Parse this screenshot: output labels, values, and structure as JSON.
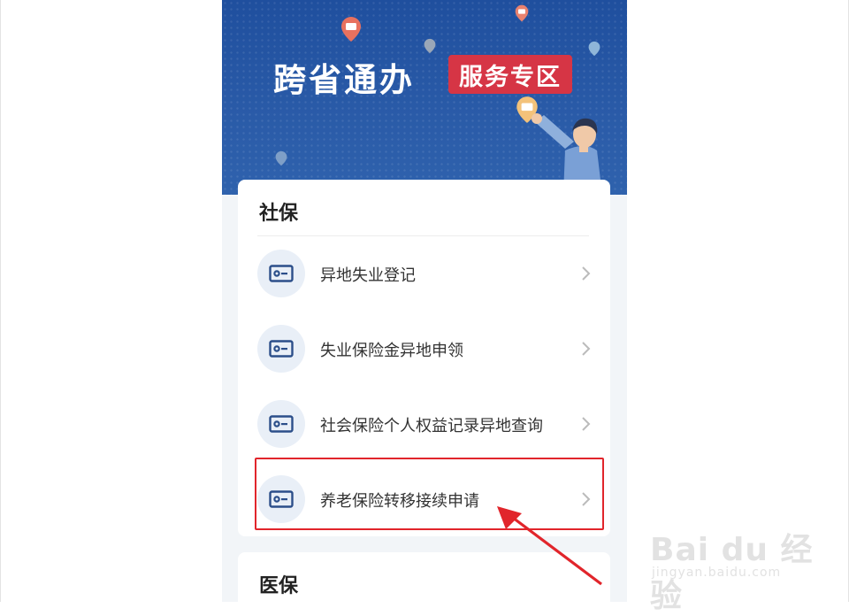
{
  "banner": {
    "title": "跨省通办",
    "badge": "服务专区"
  },
  "sections": [
    {
      "title": "社保",
      "items": [
        {
          "label": "异地失业登记",
          "icon": "id-card-icon"
        },
        {
          "label": "失业保险金异地申领",
          "icon": "id-card-icon"
        },
        {
          "label": "社会保险个人权益记录异地查询",
          "icon": "id-card-icon"
        },
        {
          "label": "养老保险转移接续申请",
          "icon": "id-card-icon"
        }
      ]
    },
    {
      "title": "医保"
    }
  ],
  "watermark": {
    "logo": "Bai du 经验",
    "site": "jingyan.baidu.com"
  },
  "colors": {
    "banner": "#2a5ba8",
    "badge": "#d63545",
    "icon": "#2c4f8a",
    "highlight": "#e1252b"
  }
}
